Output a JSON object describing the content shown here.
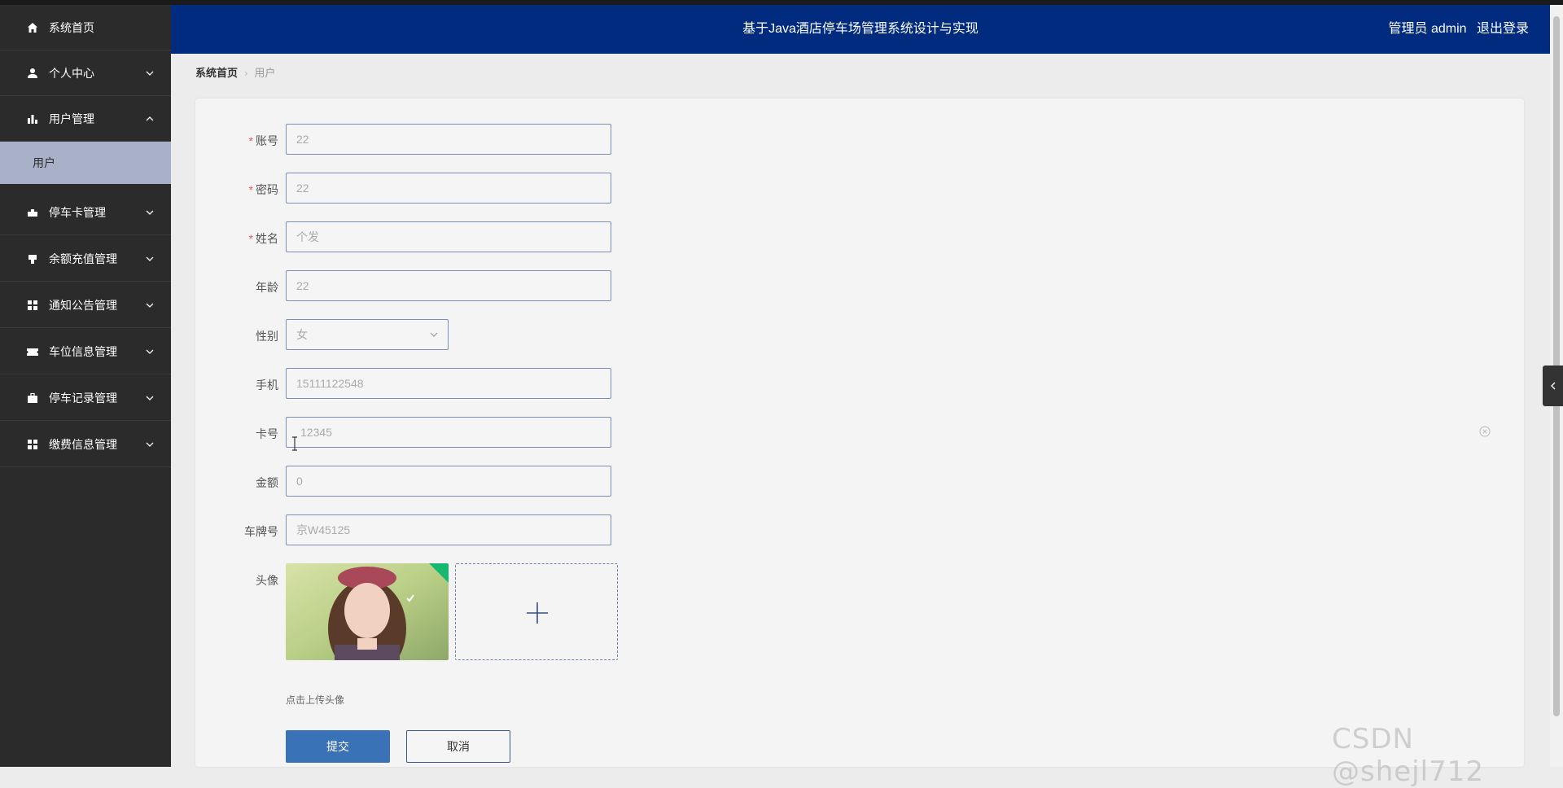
{
  "app": {
    "title": "基于Java酒店停车场管理系统设计与实现",
    "user_label": "管理员 admin",
    "logout": "退出登录"
  },
  "sidebar": {
    "items": [
      {
        "label": "系统首页",
        "icon": "home-icon",
        "expanded": null
      },
      {
        "label": "个人中心",
        "icon": "person-icon",
        "expanded": false
      },
      {
        "label": "用户管理",
        "icon": "bar-chart-icon",
        "expanded": true
      },
      {
        "label": "停车卡管理",
        "icon": "card-icon",
        "expanded": false
      },
      {
        "label": "余额充值管理",
        "icon": "recharge-icon",
        "expanded": false
      },
      {
        "label": "通知公告管理",
        "icon": "grid-icon",
        "expanded": false
      },
      {
        "label": "车位信息管理",
        "icon": "ticket-icon",
        "expanded": false
      },
      {
        "label": "停车记录管理",
        "icon": "briefcase-icon",
        "expanded": false
      },
      {
        "label": "缴费信息管理",
        "icon": "grid-icon",
        "expanded": false
      }
    ],
    "active_sub": "用户"
  },
  "breadcrumb": {
    "home": "系统首页",
    "current": "用户"
  },
  "form": {
    "account": {
      "label": "账号",
      "value": "22",
      "required": true
    },
    "password": {
      "label": "密码",
      "value": "22",
      "required": true
    },
    "name": {
      "label": "姓名",
      "value": "个发",
      "required": true
    },
    "age": {
      "label": "年龄",
      "value": "22",
      "required": false
    },
    "gender": {
      "label": "性别",
      "value": "女",
      "required": false
    },
    "phone": {
      "label": "手机",
      "value": "15111122548",
      "required": false
    },
    "card": {
      "label": "卡号",
      "value": "12345",
      "required": false
    },
    "amount": {
      "label": "金额",
      "value": "0",
      "required": false
    },
    "plate": {
      "label": "车牌号",
      "value": "京W45125",
      "required": false
    },
    "avatar": {
      "label": "头像",
      "hint": "点击上传头像"
    },
    "submit": "提交",
    "cancel": "取消"
  },
  "watermark": "CSDN @shejl712",
  "colors": {
    "header_bg": "#002b7e",
    "sidebar_bg": "#2b2b2b",
    "sub_active_bg": "#a9b1c8",
    "primary": "#3a72b8",
    "required": "#e45a5a"
  }
}
